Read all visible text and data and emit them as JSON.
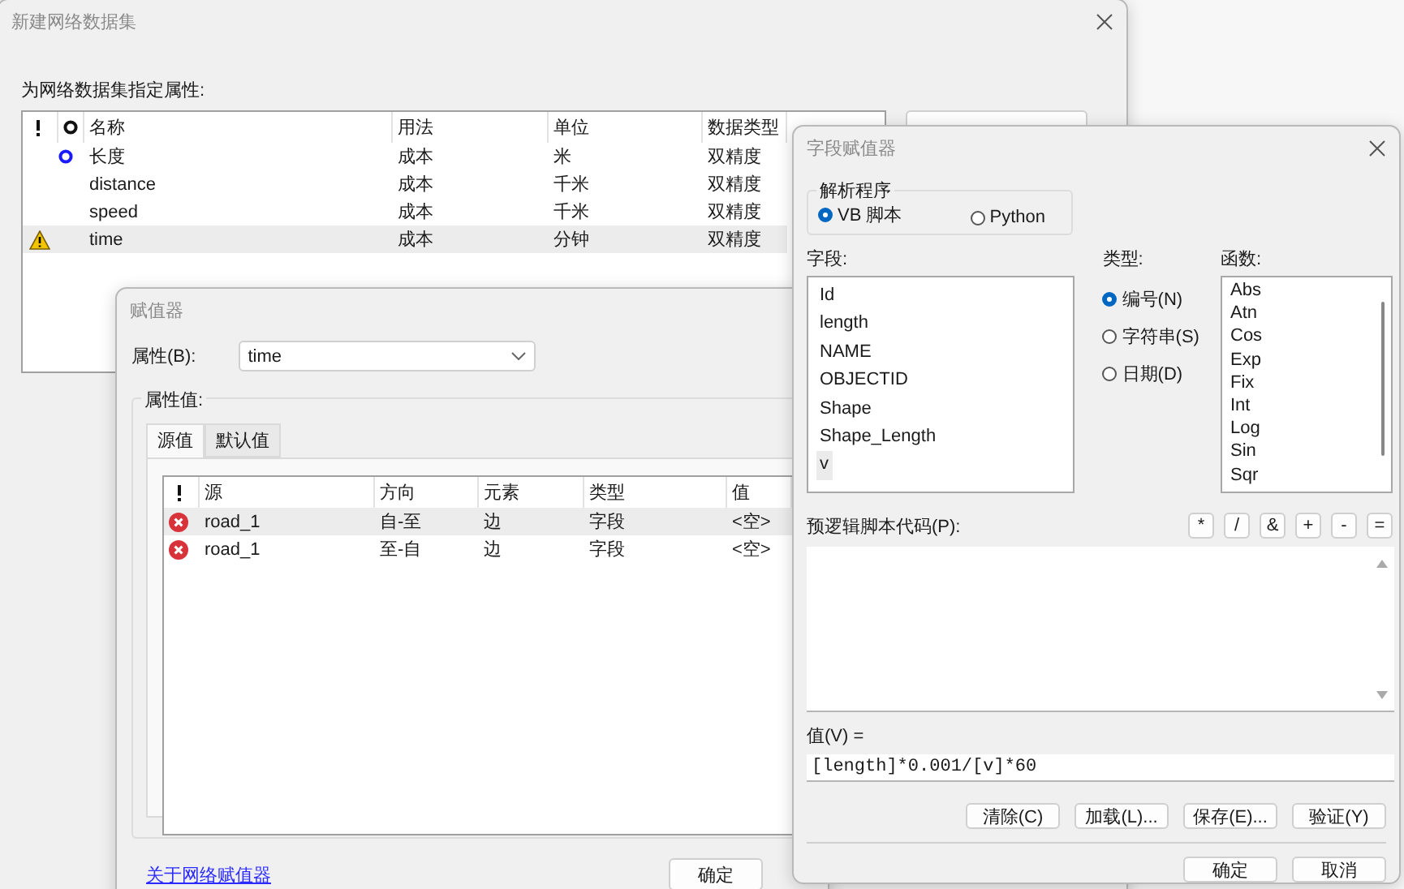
{
  "network_dialog": {
    "title": "新建网络数据集",
    "label": "为网络数据集指定属性:",
    "columns": [
      "名称",
      "用法",
      "单位",
      "数据类型"
    ],
    "rows": [
      {
        "name": "长度",
        "usage": "成本",
        "unit": "米",
        "type": "双精度",
        "default": true,
        "warning": false,
        "selected": false
      },
      {
        "name": "distance",
        "usage": "成本",
        "unit": "千米",
        "type": "双精度",
        "default": false,
        "warning": false,
        "selected": false
      },
      {
        "name": "speed",
        "usage": "成本",
        "unit": "千米",
        "type": "双精度",
        "default": false,
        "warning": false,
        "selected": false
      },
      {
        "name": "time",
        "usage": "成本",
        "unit": "分钟",
        "type": "双精度",
        "default": false,
        "warning": true,
        "selected": true
      }
    ]
  },
  "evaluator_dialog": {
    "title": "赋值器",
    "attribute_label": "属性(B):",
    "attribute_value": "time",
    "group_label": "属性值:",
    "tabs": [
      {
        "label": "源值",
        "selected": true
      },
      {
        "label": "默认值",
        "selected": false
      }
    ],
    "columns": [
      "源",
      "方向",
      "元素",
      "类型",
      "值"
    ],
    "rows": [
      {
        "source": "road_1",
        "direction": "自-至",
        "element": "边",
        "type": "字段",
        "value": "<空>",
        "error": true,
        "selected": true
      },
      {
        "source": "road_1",
        "direction": "至-自",
        "element": "边",
        "type": "字段",
        "value": "<空>",
        "error": true,
        "selected": false
      }
    ],
    "link": "关于网络赋值器",
    "ok_button": "确定"
  },
  "field_calculator": {
    "title": "字段赋值器",
    "parser_label": "解析程序",
    "parsers": [
      {
        "label": "VB 脚本",
        "selected": true
      },
      {
        "label": "Python",
        "selected": false
      }
    ],
    "fields_label": "字段:",
    "fields": [
      {
        "label": "Id",
        "selected": false
      },
      {
        "label": "length",
        "selected": false
      },
      {
        "label": "NAME",
        "selected": false
      },
      {
        "label": "OBJECTID",
        "selected": false
      },
      {
        "label": "Shape",
        "selected": false
      },
      {
        "label": "Shape_Length",
        "selected": false
      },
      {
        "label": "v",
        "selected": true
      }
    ],
    "type_label": "类型:",
    "types": [
      {
        "label": "编号(N)",
        "selected": true
      },
      {
        "label": "字符串(S)",
        "selected": false
      },
      {
        "label": "日期(D)",
        "selected": false
      }
    ],
    "functions_label": "函数:",
    "functions": [
      "Abs",
      "Atn",
      "Cos",
      "Exp",
      "Fix",
      "Int",
      "Log",
      "Sin",
      "Sqr"
    ],
    "prelogic_label": "预逻辑脚本代码(P):",
    "operators": [
      "*",
      "/",
      "&",
      "+",
      "-",
      "="
    ],
    "value_label": "值(V) =",
    "expression": "[length]*0.001/[v]*60",
    "actions": [
      "清除(C)",
      "加载(L)...",
      "保存(E)...",
      "验证(Y)"
    ],
    "ok_button": "确定",
    "cancel_button": "取消"
  }
}
